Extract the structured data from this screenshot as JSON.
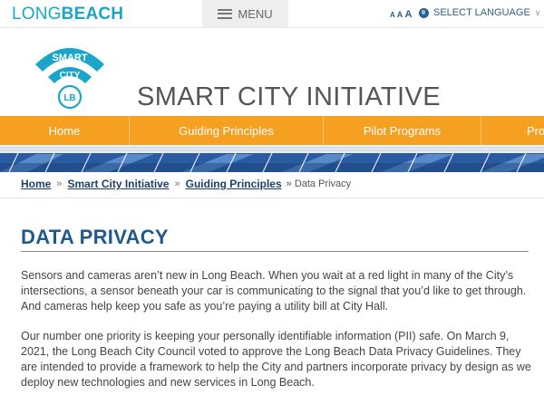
{
  "topbar": {
    "brand_part1": "LONG",
    "brand_part2": "BEACH",
    "menu_label": "MENU",
    "text_size": [
      "A",
      "A",
      "A"
    ],
    "language_label": "SELECT LANGUAGE"
  },
  "logo": {
    "line1": "SMART",
    "line2": "CITY",
    "line3": "LB"
  },
  "site_title": "SMART CITY INITIATIVE",
  "nav": {
    "items": [
      "Home",
      "Guiding Principles",
      "Pilot Programs",
      "Pro"
    ]
  },
  "breadcrumb": {
    "items": [
      "Home",
      "Smart City Initiative",
      "Guiding Principles"
    ],
    "separator": "»",
    "current": "» Data Privacy"
  },
  "page": {
    "title": "DATA PRIVACY",
    "paragraphs": [
      "Sensors and cameras aren’t new in Long Beach. When you wait at a red light in many of the City’s intersections, a sensor beneath your car is communicating to the signal that you’d like to get through. And cameras help keep you safe as you’re paying a utility bill at City Hall.",
      "Our number one priority is keeping your personally identifiable information (PII) safe. On March 9, 2021, the Long Beach City Council voted to approve the Long Beach Data Privacy Guidelines. They are intended to provide a framework to help the City and partners incorporate privacy by design as we deploy new technologies and new services in Long Beach."
    ]
  },
  "colors": {
    "brand": "#1ba6c9",
    "nav_orange": "#f5a020",
    "title_blue": "#1e5a8c",
    "link_navy": "#1b3f6a"
  }
}
